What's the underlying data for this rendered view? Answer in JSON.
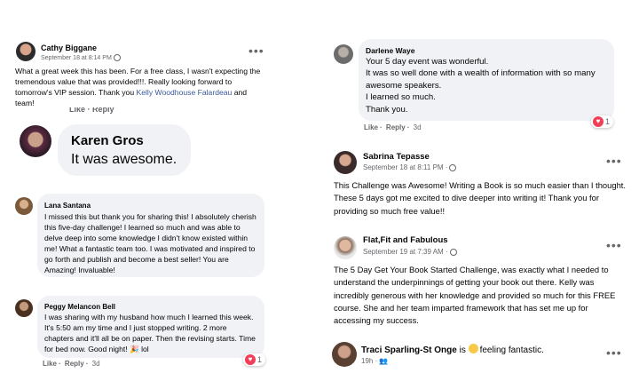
{
  "c1": {
    "name": "Cathy Biggane",
    "time": "September 18 at 8:14 PM",
    "text_a": "What a great week this has been.  For a free class, I wasn't expecting the tremendous value that was provided!!!.  Really looking forward to tomorrow's VIP session.  Thank you ",
    "link": "Kelly Woodhouse Falardeau",
    "text_b": " and team!",
    "partial_actions": "Like · Reply"
  },
  "c2": {
    "name": "Karen Gros",
    "text": "It was awesome."
  },
  "c3": {
    "name": "Lana Santana",
    "text": "I missed this but thank you for sharing this! I absolutely cherish this five-day challenge! I learned so much and was able to delve deep into some knowledge I didn't know existed within me! What a fantastic team too. I was motivated and inspired to go forth and publish and become a best seller! You are Amazing! Invaluable!"
  },
  "c4": {
    "name": "Peggy Melancon Bell",
    "text": "I was sharing with my husband how much I learned this week. It's 5:50 am my time and I just stopped writing. 2 more chapters and it'll all be on paper. Then the revising starts. Time for bed now. Good night! 🎉 lol",
    "like": "Like",
    "reply": "Reply",
    "age": "3d",
    "reactions": "1"
  },
  "c5": {
    "name": "Darlene Waye",
    "line1": "Your 5 day event was wonderful.",
    "line2": "It was so well done with a wealth of information with so many awesome speakers.",
    "line3": "I learned so much.",
    "line4": "Thank you.",
    "like": "Like",
    "reply": "Reply",
    "age": "3d",
    "reactions": "1"
  },
  "c6": {
    "name": "Sabrina Tepasse",
    "time": "September 18 at 8:11 PM ·",
    "text": "This Challenge was Awesome! Writing a Book is so much easier than I thought. These 5 days got me excited to dive deeper into writing it! Thank you for providing so much free value!!"
  },
  "c7": {
    "name": "Flat,Fit and Fabulous",
    "time": "September 19 at 7:39 AM ·",
    "text": "The 5 Day Get Your Book Started Challenge, was exactly what I needed to understand the underpinnings of getting your book out there.  Kelly was incredibly generous with her knowledge and provided so much for this FREE course.  She and her team imparted framework that has set me up for accessing my success."
  },
  "c8": {
    "name": "Traci Sparling-St Onge",
    "is": " is ",
    "feeling": "feeling fantastic.",
    "age": "19h ·"
  },
  "colors": {
    "bubble": "#f0f2f5",
    "link": "#385898",
    "meta": "#65676b",
    "heart": "#f33e58"
  }
}
